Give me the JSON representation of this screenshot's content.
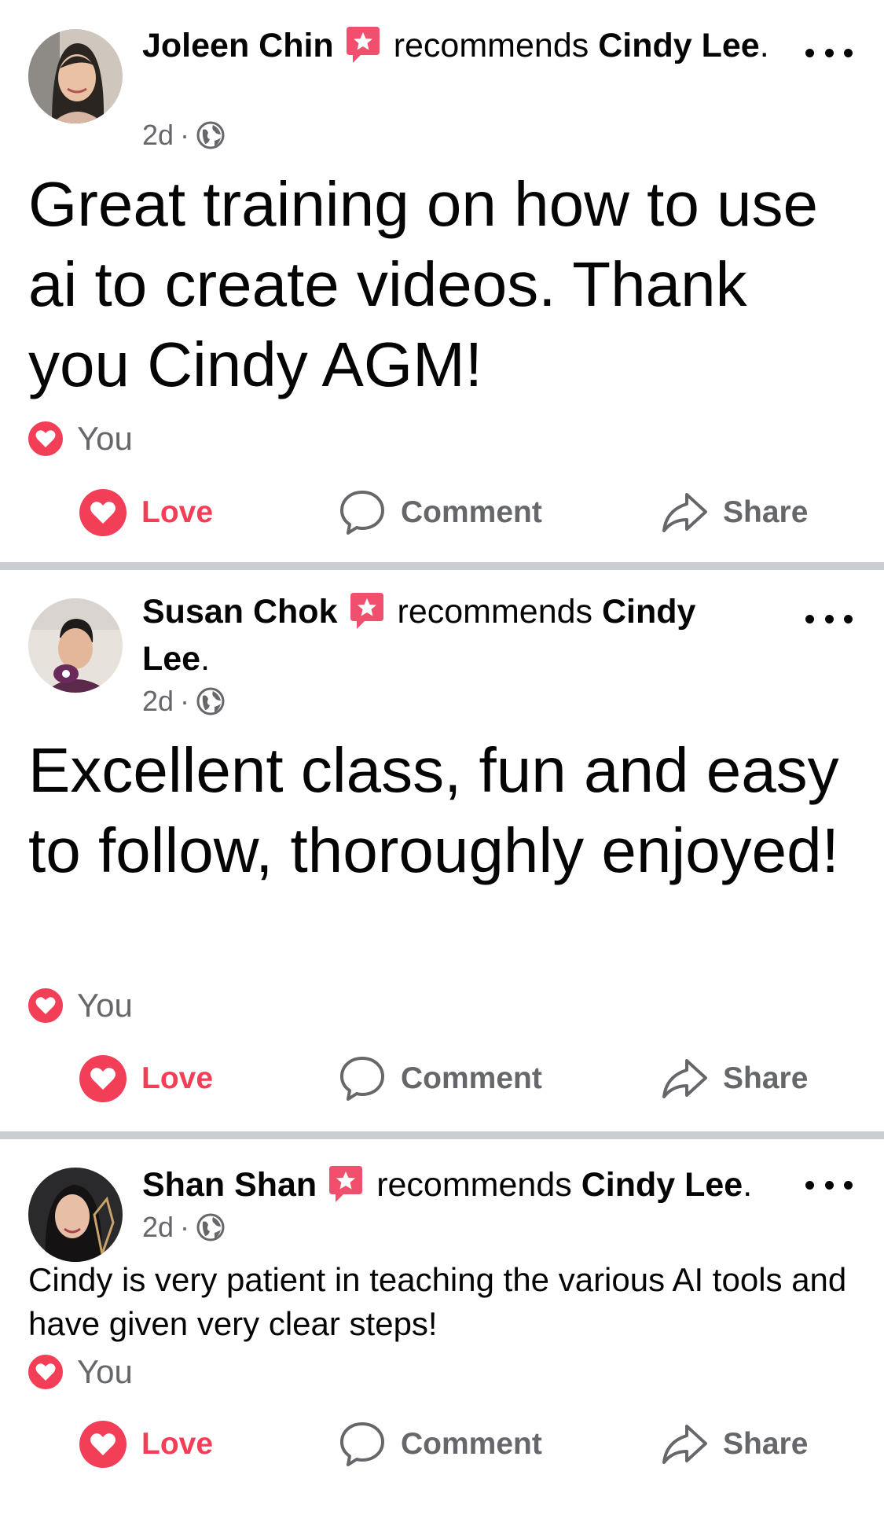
{
  "colors": {
    "love": "#f33e58",
    "secondary_text": "#65676b",
    "divider": "#c9ccd1",
    "badge": "#f0506e"
  },
  "icons": {
    "recommend_badge": "recommend-star-badge-icon",
    "audience": "globe-icon",
    "more": "more-dots-icon",
    "reaction": "heart-reaction-icon",
    "love": "heart-icon",
    "comment": "comment-bubble-icon",
    "share": "share-arrow-icon"
  },
  "posts": [
    {
      "author": "Joleen Chin",
      "recommends": "recommends",
      "page": "Cindy Lee",
      "period": ".",
      "time": "2d",
      "separator": "·",
      "text": "Great training on how to use ai to create videos. Thank you Cindy AGM!",
      "reaction_by": "You",
      "actions": {
        "love": "Love",
        "comment": "Comment",
        "share": "Share"
      }
    },
    {
      "author": "Susan Chok",
      "recommends": "recommends",
      "page": "Cindy Lee",
      "period": ".",
      "time": "2d",
      "separator": "·",
      "text": "Excellent class, fun and easy to follow, thoroughly enjoyed!",
      "reaction_by": "You",
      "actions": {
        "love": "Love",
        "comment": "Comment",
        "share": "Share"
      }
    },
    {
      "author": "Shan Shan",
      "recommends": "recommends",
      "page": "Cindy Lee",
      "period": ".",
      "time": "2d",
      "separator": "·",
      "text": "Cindy is very patient in teaching the various AI tools and have given very clear steps!",
      "reaction_by": "You",
      "actions": {
        "love": "Love",
        "comment": "Comment",
        "share": "Share"
      }
    }
  ]
}
